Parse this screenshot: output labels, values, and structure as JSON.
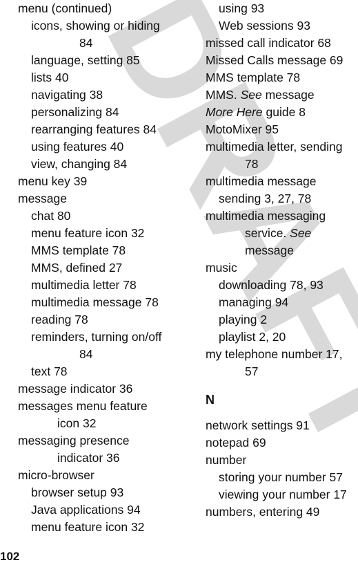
{
  "watermark": "DRAFT",
  "page_number": "102",
  "left_column": [
    {
      "text": "menu (continued)",
      "level": 1
    },
    {
      "text": "icons, showing or hiding",
      "level": 2
    },
    {
      "text": "84",
      "level": "cont2"
    },
    {
      "text": "language, setting  85",
      "level": 2
    },
    {
      "text": "lists  40",
      "level": 2
    },
    {
      "text": "navigating  38",
      "level": 2
    },
    {
      "text": "personalizing  84",
      "level": 2
    },
    {
      "text": "rearranging features  84",
      "level": 2
    },
    {
      "text": "using features  40",
      "level": 2
    },
    {
      "text": "view, changing  84",
      "level": 2
    },
    {
      "text": "menu key  39",
      "level": 1
    },
    {
      "text": "message",
      "level": 1
    },
    {
      "text": "chat  80",
      "level": 2
    },
    {
      "text": "menu feature icon  32",
      "level": 2
    },
    {
      "text": "MMS template  78",
      "level": 2
    },
    {
      "text": "MMS, defined  27",
      "level": 2
    },
    {
      "text": "multimedia letter  78",
      "level": 2
    },
    {
      "text": "multimedia message  78",
      "level": 2
    },
    {
      "text": "reading  78",
      "level": 2
    },
    {
      "text": "reminders, turning on/off",
      "level": 2
    },
    {
      "text": "84",
      "level": "cont2"
    },
    {
      "text": "text  78",
      "level": 2
    },
    {
      "text": "message indicator  36",
      "level": 1
    },
    {
      "text": "messages menu feature",
      "level": 1
    },
    {
      "text": "icon  32",
      "level": "cont1"
    },
    {
      "text": "messaging presence",
      "level": 1
    },
    {
      "text": "indicator  36",
      "level": "cont1"
    },
    {
      "text": "micro-browser",
      "level": 1
    },
    {
      "text": "browser setup  93",
      "level": 2
    },
    {
      "text": "Java applications  94",
      "level": 2
    },
    {
      "text": "menu feature icon  32",
      "level": 2
    }
  ],
  "right_column": {
    "entries_m": [
      {
        "text": "using  93",
        "level": 2
      },
      {
        "text": "Web sessions  93",
        "level": 2
      },
      {
        "text": "missed call indicator  68",
        "level": 1
      },
      {
        "text": "Missed Calls message  69",
        "level": 1
      },
      {
        "text": "MMS template  78",
        "level": 1
      },
      {
        "pre": "MMS. ",
        "italic": "See",
        "post": " message",
        "level": 1
      },
      {
        "pre": "",
        "italic": "More Here",
        "post": " guide  8",
        "level": 1
      },
      {
        "text": "MotoMixer  95",
        "level": 1
      },
      {
        "text": "multimedia letter, sending",
        "level": 1
      },
      {
        "text": "78",
        "level": "cont1"
      },
      {
        "text": "multimedia message",
        "level": 1
      },
      {
        "text": "sending  3, 27, 78",
        "level": 2
      },
      {
        "text": "multimedia messaging",
        "level": 1
      },
      {
        "pre": "service. ",
        "italic": "See",
        "post": "",
        "level": "cont1"
      },
      {
        "text": "message",
        "level": "cont1"
      },
      {
        "text": "music",
        "level": 1
      },
      {
        "text": "downloading  78, 93",
        "level": 2
      },
      {
        "text": "managing  94",
        "level": 2
      },
      {
        "text": "playing  2",
        "level": 2
      },
      {
        "text": "playlist  2, 20",
        "level": 2
      },
      {
        "text": "my telephone number  17,",
        "level": 1
      },
      {
        "text": "57",
        "level": "cont1"
      }
    ],
    "section_letter": "N",
    "entries_n": [
      {
        "text": "network settings  91",
        "level": 1
      },
      {
        "text": "notepad  69",
        "level": 1
      },
      {
        "text": "number",
        "level": 1
      },
      {
        "text": "storing your number  57",
        "level": 2
      },
      {
        "text": "viewing your number  17",
        "level": 2
      },
      {
        "text": "numbers, entering  49",
        "level": 1
      }
    ]
  }
}
